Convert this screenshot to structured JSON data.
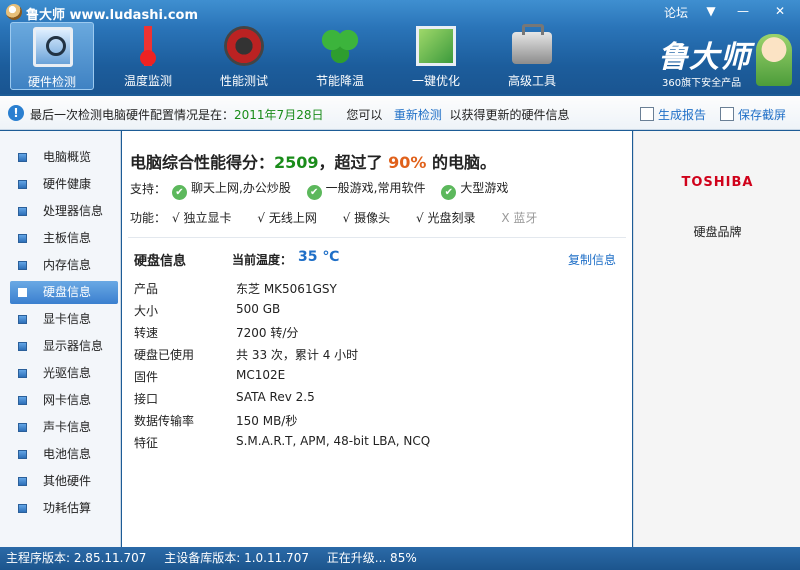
{
  "window": {
    "title": "鲁大师 www.ludashi.com",
    "forum": "论坛",
    "menu_glyph": "▼",
    "min_glyph": "—",
    "close_glyph": "✕"
  },
  "nav": [
    {
      "label": "硬件检测",
      "icon": "monitor-magnifier-icon",
      "active": true
    },
    {
      "label": "温度监测",
      "icon": "thermometer-icon"
    },
    {
      "label": "性能测试",
      "icon": "speed-gauge-icon"
    },
    {
      "label": "节能降温",
      "icon": "clover-icon"
    },
    {
      "label": "一键优化",
      "icon": "optimize-screen-icon"
    },
    {
      "label": "高级工具",
      "icon": "toolbox-icon"
    }
  ],
  "brand": {
    "name": "鲁大师",
    "slogan": "360旗下安全产品"
  },
  "infobar": {
    "prefix": "最后一次检测电脑硬件配置情况是在：",
    "date": "2011年7月28日",
    "middle": "您可以",
    "retest": "重新检测",
    "suffix": "以获得更新的硬件信息",
    "report": "生成报告",
    "screenshot": "保存截屏"
  },
  "sidebar": [
    "电脑概览",
    "硬件健康",
    "处理器信息",
    "主板信息",
    "内存信息",
    "硬盘信息",
    "显卡信息",
    "显示器信息",
    "光驱信息",
    "网卡信息",
    "声卡信息",
    "电池信息",
    "其他硬件",
    "功耗估算"
  ],
  "sidebar_active_index": 5,
  "score": {
    "prefix": "电脑综合性能得分：",
    "value": "2509",
    "mid": "，超过了",
    "percent": "90%",
    "suffix": "的电脑。"
  },
  "support": {
    "label": "支持：",
    "items": [
      "聊天上网,办公炒股",
      "一般游戏,常用软件",
      "大型游戏"
    ]
  },
  "functions": {
    "label": "功能：",
    "items": [
      {
        "mark": "√",
        "text": "独立显卡",
        "ok": true
      },
      {
        "mark": "√",
        "text": "无线上网",
        "ok": true
      },
      {
        "mark": "√",
        "text": "摄像头",
        "ok": true
      },
      {
        "mark": "√",
        "text": "光盘刻录",
        "ok": true
      },
      {
        "mark": "X",
        "text": "蓝牙",
        "ok": false
      }
    ]
  },
  "harddisk": {
    "title": "硬盘信息",
    "temp_label": "当前温度：",
    "temp_value": "35 ℃",
    "copy": "复制信息",
    "specs": [
      {
        "key": "产品",
        "value": "东芝  MK5061GSY"
      },
      {
        "key": "大小",
        "value": "500 GB"
      },
      {
        "key": "转速",
        "value": "7200 转/分"
      },
      {
        "key": "硬盘已使用",
        "value": "共 33 次，累计 4 小时"
      },
      {
        "key": "固件",
        "value": "MC102E"
      },
      {
        "key": "接口",
        "value": "SATA Rev 2.5"
      },
      {
        "key": "数据传输率",
        "value": "150 MB/秒"
      },
      {
        "key": "特征",
        "value": "S.M.A.R.T,  APM,  48-bit LBA,  NCQ"
      }
    ]
  },
  "right_panel": {
    "logo": "TOSHIBA",
    "caption": "硬盘品牌"
  },
  "status": {
    "main_version": "主程序版本: 2.85.11.707",
    "db_version": "主设备库版本: 1.0.11.707",
    "upgrade": "正在升级... 85%"
  },
  "colors": {
    "titlebar": "#2a74b8",
    "score_green": "#1a8c1a",
    "score_orange": "#e0611b",
    "link_blue": "#1f6fc7",
    "toshiba_red": "#d0021b"
  }
}
